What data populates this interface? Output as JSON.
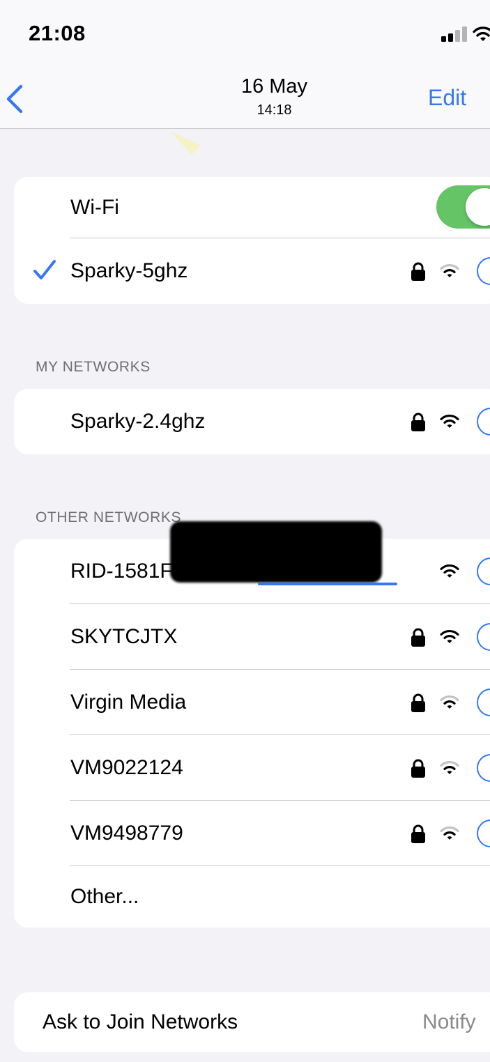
{
  "status": {
    "time": "21:08"
  },
  "nav": {
    "date": "16 May",
    "time": "14:18",
    "edit_label": "Edit"
  },
  "wifi_toggle": {
    "label": "Wi-Fi",
    "on": true
  },
  "connected_network": {
    "name": "Sparky-5ghz",
    "secured": true,
    "signal": "medium"
  },
  "my_networks": {
    "header": "MY NETWORKS",
    "items": [
      {
        "name": "Sparky-2.4ghz",
        "secured": true,
        "signal": "full"
      }
    ]
  },
  "other_networks": {
    "header": "OTHER NETWORKS",
    "items": [
      {
        "name": "RID-1581F4",
        "secured": false,
        "signal": "full"
      },
      {
        "name": "SKYTCJTX",
        "secured": true,
        "signal": "full"
      },
      {
        "name": "Virgin Media",
        "secured": true,
        "signal": "medium"
      },
      {
        "name": "VM9022124",
        "secured": true,
        "signal": "medium"
      },
      {
        "name": "VM9498779",
        "secured": true,
        "signal": "medium"
      }
    ],
    "other_label": "Other..."
  },
  "ask_to_join": {
    "label": "Ask to Join Networks",
    "value": "Notify"
  },
  "colors": {
    "accent": "#3478f6",
    "toggle_on": "#65c466",
    "background": "#f2f2f7"
  }
}
